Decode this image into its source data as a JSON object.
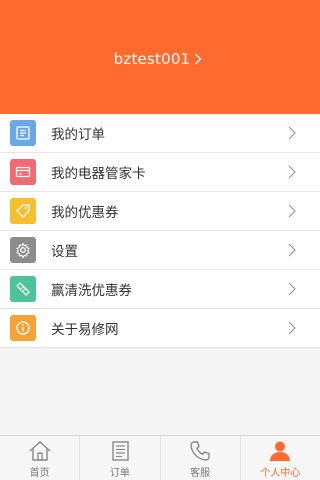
{
  "header": {
    "username": "bztest001",
    "background_color": "#ff6a2e",
    "chevron_icon": "chevron-right-icon"
  },
  "menu": {
    "items": [
      {
        "label": "我的订单",
        "icon": "order-list-icon",
        "icon_color": "#6aa7e6"
      },
      {
        "label": "我的电器管家卡",
        "icon": "card-icon",
        "icon_color": "#f06b72"
      },
      {
        "label": "我的优惠券",
        "icon": "tag-icon",
        "icon_color": "#f7be2e"
      },
      {
        "label": "设置",
        "icon": "gear-icon",
        "icon_color": "#8c8c8c"
      },
      {
        "label": "赢清洗优惠券",
        "icon": "ticket-icon",
        "icon_color": "#4cc49a"
      },
      {
        "label": "关于易修网",
        "icon": "info-icon",
        "icon_color": "#f5a237"
      }
    ]
  },
  "tabbar": {
    "tabs": [
      {
        "label": "首页",
        "icon": "home-icon",
        "active": false
      },
      {
        "label": "订单",
        "icon": "document-icon",
        "active": false
      },
      {
        "label": "客服",
        "icon": "phone-icon",
        "active": false
      },
      {
        "label": "个人中心",
        "icon": "person-icon",
        "active": true
      }
    ],
    "active_color": "#ff6a2e",
    "inactive_color": "#777777"
  }
}
